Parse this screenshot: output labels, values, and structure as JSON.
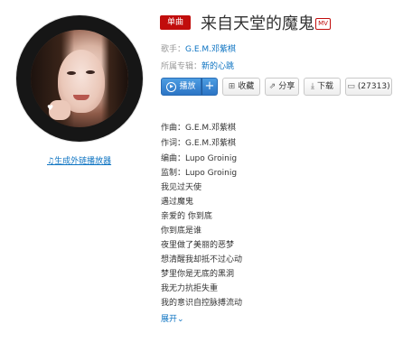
{
  "player": {
    "external_player_link": "生成外链播放器"
  },
  "song": {
    "badge": "单曲",
    "title": "来自天堂的魔鬼",
    "mv_badge": "MV",
    "singer_label": "歌手：",
    "singer": "G.E.M.邓紫棋",
    "album_label": "所属专辑：",
    "album": "新的心跳"
  },
  "actions": {
    "play": "播放",
    "add": "+",
    "favorite": "收藏",
    "share": "分享",
    "download": "下载",
    "comments": "(27313)"
  },
  "lyrics": {
    "lines": [
      "作曲：G.E.M.邓紫棋",
      "作词：G.E.M.邓紫棋",
      "编曲：Lupo Groinig",
      "监制：Lupo Groinig",
      "我见过天使",
      "遇过魔鬼",
      "亲爱的 你到底",
      "你到底是谁",
      "夜里做了美丽的恶梦",
      "想清醒我却抵不过心动",
      "梦里你是无底的黑洞",
      "我无力抗拒失重",
      "我的意识自控脉搏流动"
    ],
    "expand": "展开"
  },
  "colors": {
    "accent_red": "#c10d0c",
    "link_blue": "#0c73c2",
    "play_blue": "#2b74c5"
  },
  "icons": {
    "music_note": "music-note-icon",
    "play": "play-circle-icon",
    "favorite": "folder-plus-icon",
    "share": "share-icon",
    "download": "download-icon",
    "comment": "comment-icon",
    "expand": "chevron-down-icon"
  }
}
